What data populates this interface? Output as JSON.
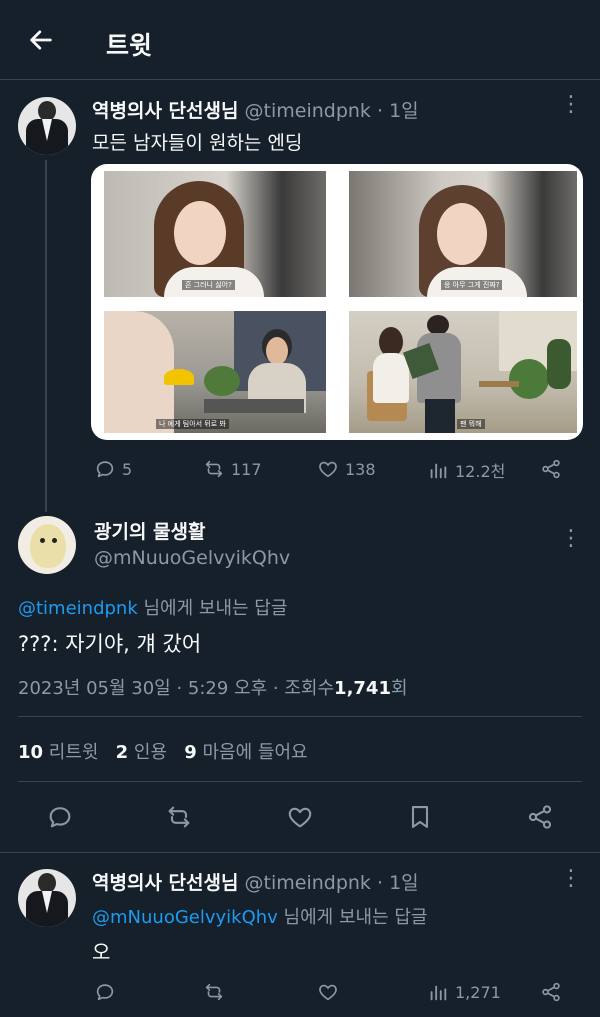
{
  "header": {
    "title": "트윗"
  },
  "tweet1": {
    "display_name": "역병의사 단선생님",
    "handle": "@timeindpnk",
    "separator": "·",
    "age": "1일",
    "text": "모든 남자들이 원하는 엔딩",
    "media": {
      "subtitles": [
        "흔 그러니 싫어?",
        "응 아무 그게 진짜?",
        "나 에게 팀아서 뒤로 봐",
        "팬 뭐해"
      ]
    },
    "actions": {
      "replies": "5",
      "retweets": "117",
      "likes": "138",
      "views": "12.2천"
    }
  },
  "focus": {
    "display_name": "광기의 물생활",
    "handle": "@mNuuoGelvyikQhv",
    "reply_to": {
      "handle": "@timeindpnk",
      "suffix": "님에게 보내는 답글"
    },
    "text": "???: 자기야, 걔 갔어",
    "meta": {
      "datetime": "2023년 05월 30일 · 5:29 오후 ·",
      "views_label": "조회수",
      "views_count": "1,741",
      "views_suffix": "회"
    },
    "stats": {
      "retweets_count": "10",
      "retweets_label": "리트윗",
      "quotes_count": "2",
      "quotes_label": "인용",
      "likes_count": "9",
      "likes_label": "마음에 들어요"
    }
  },
  "tweet2": {
    "display_name": "역병의사 단선생님",
    "handle": "@timeindpnk",
    "separator": "·",
    "age": "1일",
    "reply_to": {
      "handle": "@mNuuoGelvyikQhv",
      "suffix": "님에게 보내는 답글"
    },
    "text": "오",
    "actions": {
      "views": "1,271"
    }
  },
  "icons": [
    "back-arrow-icon",
    "more-icon",
    "reply-icon",
    "retweet-icon",
    "like-icon",
    "views-icon",
    "share-icon",
    "bookmark-icon"
  ],
  "colors": {
    "background": "#15202b",
    "text": "#f7f9f9",
    "muted": "#8b98a5",
    "link": "#1d9bf0",
    "divider": "#38444d"
  }
}
